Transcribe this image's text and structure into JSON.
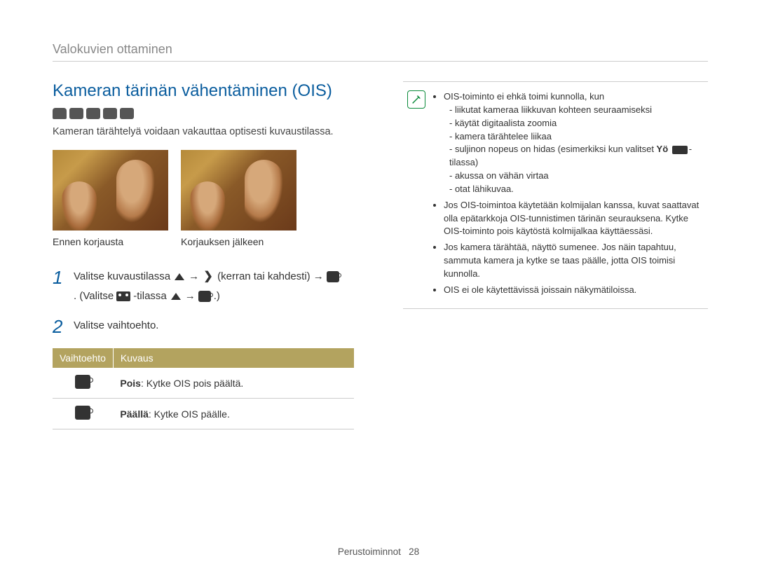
{
  "breadcrumb": "Valokuvien ottaminen",
  "title": "Kameran tärinän vähentäminen (OIS)",
  "intro": "Kameran tärähtelyä voidaan vakauttaa optisesti kuvaustilassa.",
  "photo_captions": {
    "before": "Ennen korjausta",
    "after": "Korjauksen jälkeen"
  },
  "steps": {
    "s1": {
      "num": "1",
      "part1": "Valitse kuvaustilassa",
      "part2": "(kerran tai kahdesti)",
      "part3": ". (Valitse",
      "part4": "-tilassa",
      "part5": ".)"
    },
    "s2": {
      "num": "2",
      "text": "Valitse vaihtoehto."
    }
  },
  "options_table": {
    "header_option": "Vaihtoehto",
    "header_desc": "Kuvaus",
    "row_off_bold": "Pois",
    "row_off_rest": ": Kytke OIS pois päältä.",
    "row_on_bold": "Päällä",
    "row_on_rest": ": Kytke OIS päälle."
  },
  "notes": {
    "n1": "OIS-toiminto ei ehkä toimi kunnolla, kun",
    "n1a": "liikutat kameraa liikkuvan kohteen seuraamiseksi",
    "n1b": "käytät digitaalista zoomia",
    "n1c": "kamera tärähtelee liikaa",
    "n1d_a": "suljinon nopeus on hidas (esimerkiksi kun valitset ",
    "n1d_b": "Yö",
    "n1d_c": "-tilassa)",
    "n1e": "akussa on vähän virtaa",
    "n1f": "otat lähikuvaa.",
    "n2": "Jos OIS-toimintoa käytetään kolmijalan kanssa, kuvat saattavat olla epätarkkoja OIS-tunnistimen tärinän seurauksena. Kytke OIS-toiminto pois käytöstä kolmijalkaa käyttäessäsi.",
    "n3": "Jos kamera tärähtää, näyttö sumenee. Jos näin tapahtuu, sammuta kamera ja kytke se taas päälle, jotta OIS toimisi kunnolla.",
    "n4": "OIS ei ole käytettävissä joissain näkymätiloissa."
  },
  "footer": {
    "section": "Perustoiminnot",
    "page": "28"
  }
}
